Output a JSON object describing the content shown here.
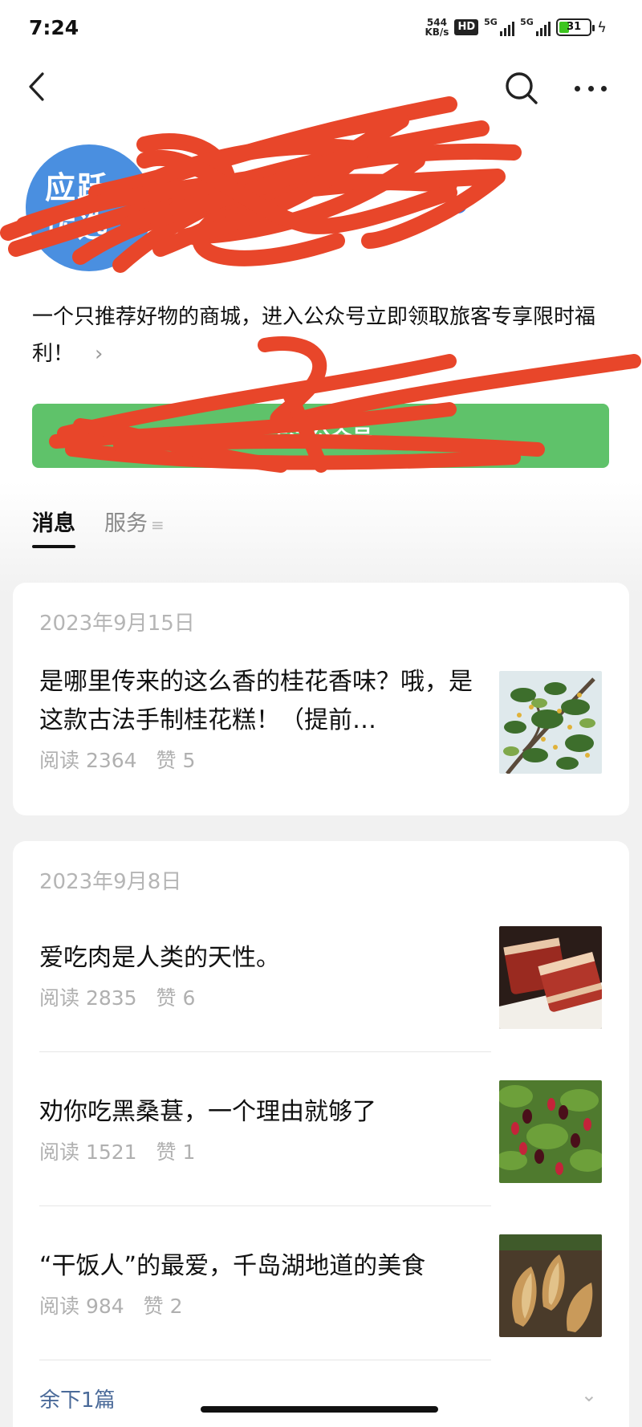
{
  "status_bar": {
    "time": "7:24",
    "net_speed_value": "544",
    "net_speed_unit": "KB/s",
    "hd_label": "HD",
    "signal1_label": "5G",
    "signal2_label": "5G",
    "battery_level": "31"
  },
  "profile": {
    "avatar_line1": "应跃",
    "avatar_line2": "优选",
    "description": "一个只推荐好物的商城，进入公众号立即领取旅客专享限时福利！"
  },
  "follow_button": {
    "label": "关注公众号"
  },
  "tabs": [
    {
      "label": "消息",
      "active": true
    },
    {
      "label": "服务",
      "active": false,
      "suffix": "≡"
    }
  ],
  "messages": [
    {
      "date": "2023年9月15日",
      "articles": [
        {
          "title": "是哪里传来的这么香的桂花香味？哦，是这款古法手制桂花糕！（提前…",
          "reads": "阅读 2364",
          "likes": "赞 5",
          "thumbnail": "osmanthus-tree"
        }
      ]
    },
    {
      "date": "2023年9月8日",
      "articles": [
        {
          "title": "爱吃肉是人类的天性。",
          "reads": "阅读 2835",
          "likes": "赞 6",
          "thumbnail": "cured-meat"
        },
        {
          "title": "劝你吃黑桑葚，一个理由就够了",
          "reads": "阅读 1521",
          "likes": "赞 1",
          "thumbnail": "mulberries"
        },
        {
          "title": "“干饭人”的最爱，千岛湖地道的美食",
          "reads": "阅读 984",
          "likes": "赞 2",
          "thumbnail": "bamboo-shoots"
        }
      ],
      "more_label": "余下1篇"
    }
  ],
  "colors": {
    "follow_green": "#5fc26a",
    "redaction_red": "#e8462a",
    "avatar_blue": "#4a8fe0"
  }
}
